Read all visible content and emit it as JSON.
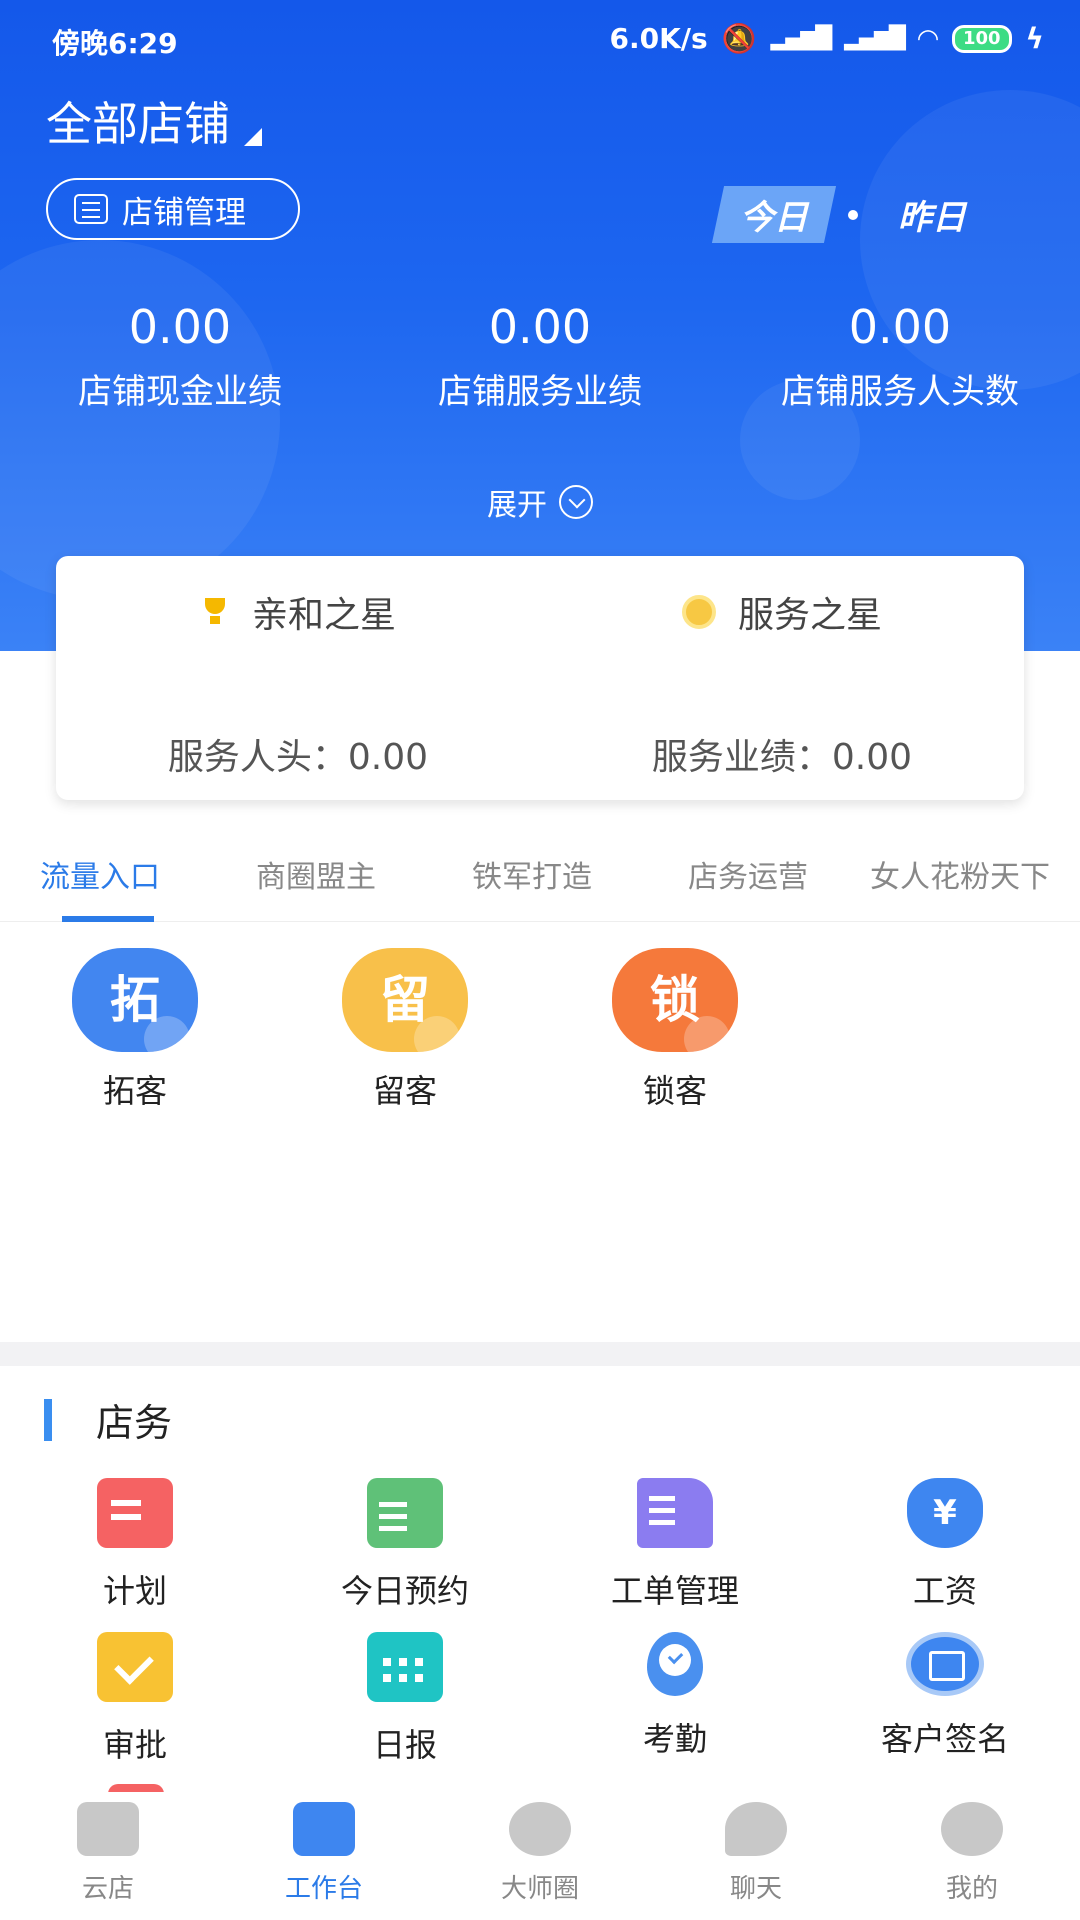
{
  "status_bar": {
    "time": "傍晚6:29",
    "speed": "6.0K/s",
    "battery": "100",
    "icons": [
      "mute-bell-icon",
      "hd-signal-icon",
      "signal-icon",
      "wifi-icon",
      "battery-icon",
      "charging-icon"
    ]
  },
  "header": {
    "store_selector": "全部店铺",
    "store_management": "店铺管理",
    "day_toggle": {
      "today": "今日",
      "yesterday": "昨日",
      "selected": "今日"
    },
    "stats": [
      {
        "value": "0.00",
        "label": "店铺现金业绩"
      },
      {
        "value": "0.00",
        "label": "店铺服务业绩"
      },
      {
        "value": "0.00",
        "label": "店铺服务人头数"
      }
    ],
    "expand_label": "展开"
  },
  "stars": {
    "left": {
      "title": "亲和之星",
      "metric": "服务人头：0.00",
      "icon": "trophy-icon"
    },
    "right": {
      "title": "服务之星",
      "metric": "服务业绩：0.00",
      "icon": "medal-icon"
    }
  },
  "tabs": {
    "items": [
      "流量入口",
      "商圈盟主",
      "铁军打造",
      "店务运营",
      "女人花粉天下"
    ],
    "active": "流量入口"
  },
  "traffic_entries": [
    {
      "glyph": "拓",
      "label": "拓客",
      "color": "#4286f0"
    },
    {
      "glyph": "留",
      "label": "留客",
      "color": "#f8c04a"
    },
    {
      "glyph": "锁",
      "label": "锁客",
      "color": "#f5793b"
    }
  ],
  "store_affairs": {
    "title": "店务",
    "items": [
      {
        "label": "计划",
        "icon": "plan-icon"
      },
      {
        "label": "今日预约",
        "icon": "calendar-clock-icon"
      },
      {
        "label": "工单管理",
        "icon": "work-order-icon"
      },
      {
        "label": "工资",
        "icon": "money-bag-icon",
        "glyph": "¥"
      },
      {
        "label": "审批",
        "icon": "approval-check-icon"
      },
      {
        "label": "日报",
        "icon": "daily-calendar-icon"
      },
      {
        "label": "考勤",
        "icon": "attendance-pin-icon"
      },
      {
        "label": "客户签名",
        "icon": "signature-icon"
      }
    ]
  },
  "bottom_nav": {
    "items": [
      {
        "label": "云店",
        "icon": "store-icon"
      },
      {
        "label": "工作台",
        "icon": "workbench-icon"
      },
      {
        "label": "大师圈",
        "icon": "circle-icon"
      },
      {
        "label": "聊天",
        "icon": "chat-icon"
      },
      {
        "label": "我的",
        "icon": "profile-icon"
      }
    ],
    "active": "工作台"
  },
  "colors": {
    "primary": "#1d66f0",
    "tab_active": "#2b7be8"
  }
}
